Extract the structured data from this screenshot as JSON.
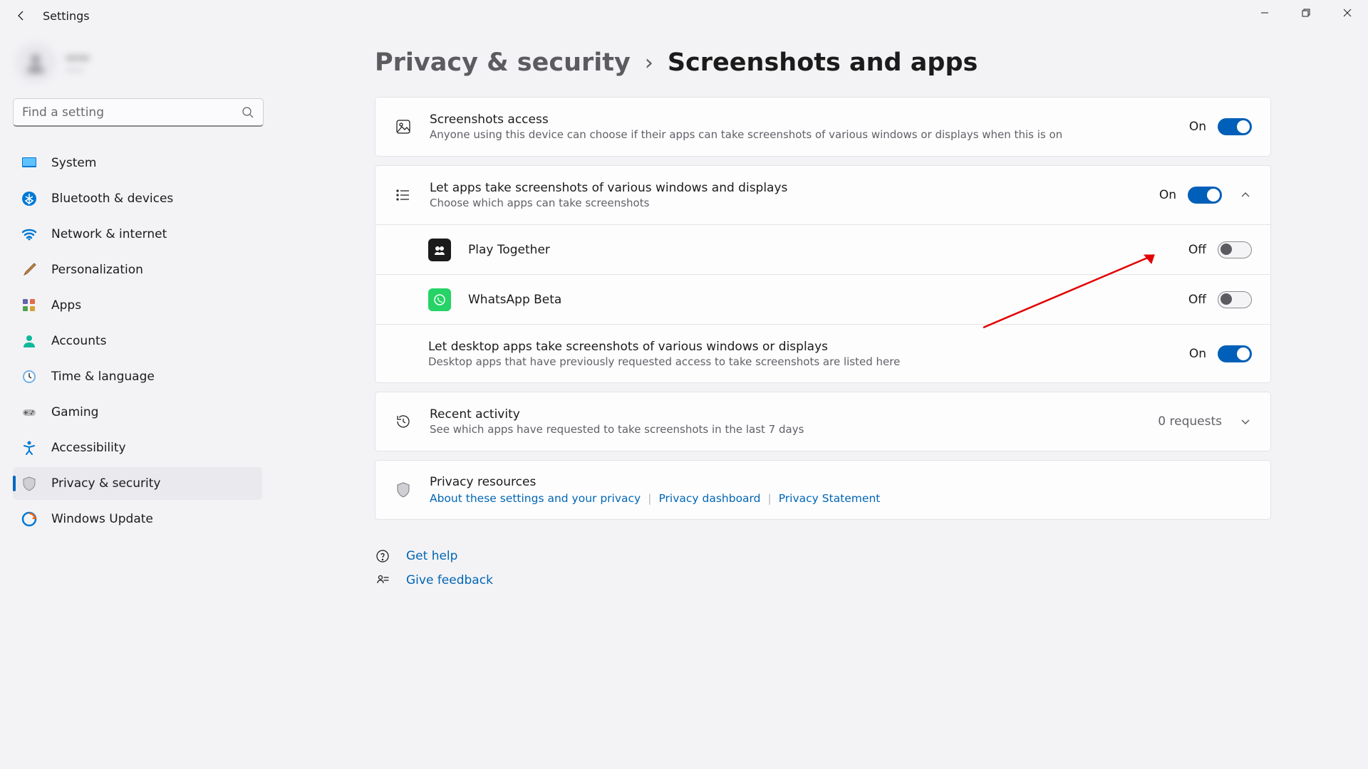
{
  "window": {
    "title": "Settings"
  },
  "profile": {
    "name": "——",
    "email": "——"
  },
  "search": {
    "placeholder": "Find a setting"
  },
  "nav": {
    "system": "System",
    "bluetooth": "Bluetooth & devices",
    "network": "Network & internet",
    "personalization": "Personalization",
    "apps": "Apps",
    "accounts": "Accounts",
    "time": "Time & language",
    "gaming": "Gaming",
    "accessibility": "Accessibility",
    "privacy": "Privacy & security",
    "update": "Windows Update"
  },
  "breadcrumb": {
    "parent": "Privacy & security",
    "separator": "›",
    "current": "Screenshots and apps"
  },
  "rows": {
    "access": {
      "title": "Screenshots access",
      "sub": "Anyone using this device can choose if their apps can take screenshots of various windows or displays when this is on",
      "state": "On"
    },
    "letApps": {
      "title": "Let apps take screenshots of various windows and displays",
      "sub": "Choose which apps can take screenshots",
      "state": "On"
    },
    "playTogether": {
      "title": "Play Together",
      "state": "Off"
    },
    "whatsapp": {
      "title": "WhatsApp Beta",
      "state": "Off"
    },
    "desktopApps": {
      "title": "Let desktop apps take screenshots of various windows or displays",
      "sub": "Desktop apps that have previously requested access to take screenshots are listed here",
      "state": "On"
    },
    "recent": {
      "title": "Recent activity",
      "sub": "See which apps have requested to take screenshots in the last 7 days",
      "requests": "0 requests"
    },
    "resources": {
      "title": "Privacy resources",
      "link1": "About these settings and your privacy",
      "link2": "Privacy dashboard",
      "link3": "Privacy Statement"
    }
  },
  "footer": {
    "help": "Get help",
    "feedback": "Give feedback"
  }
}
